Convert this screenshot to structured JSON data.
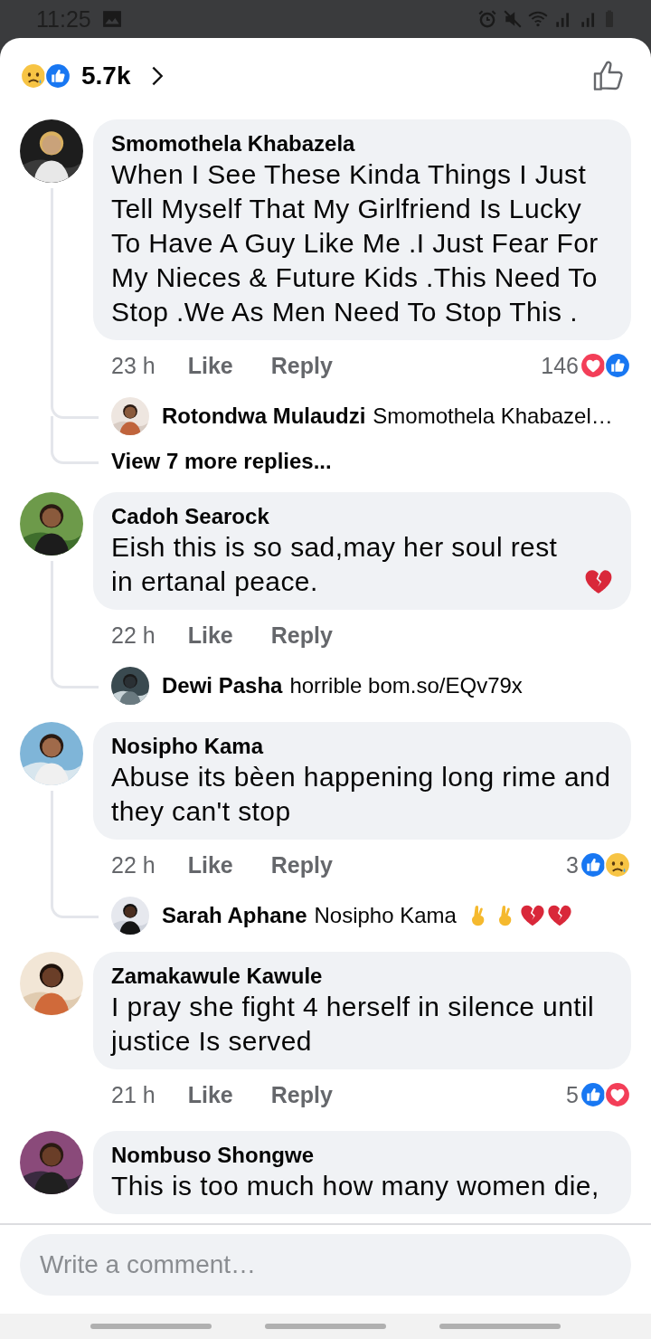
{
  "status_bar": {
    "time": "11:25"
  },
  "header": {
    "reactions": [
      {
        "kind": "sad"
      },
      {
        "kind": "like"
      }
    ],
    "count": "5.7k"
  },
  "comments": [
    {
      "author": "Smomothela Khabazela",
      "text": "When I See These Kinda Things I Just Tell Myself That My Girlfriend Is Lucky To Have A Guy Like Me .I Just Fear For My Nieces & Future Kids .This Need To Stop .We As Men Need To Stop This .",
      "time": "23 h",
      "like_label": "Like",
      "reply_label": "Reply",
      "reaction_count": "146",
      "reactions": [
        {
          "kind": "love"
        },
        {
          "kind": "like"
        }
      ],
      "replies": [
        {
          "author": "Rotondwa Mulaudzi",
          "text": "Smomothela Khabazel…"
        }
      ],
      "more_replies": "View 7 more replies..."
    },
    {
      "author": "Cadoh Searock",
      "text": "Eish this is so sad,may her soul rest in ertanal peace.",
      "emojis": [
        {
          "kind": "broken_heart"
        }
      ],
      "time": "22 h",
      "like_label": "Like",
      "reply_label": "Reply",
      "replies": [
        {
          "author": "Dewi Pasha",
          "text": "horrible bom.so/EQv79x"
        }
      ]
    },
    {
      "author": "Nosipho Kama",
      "text": "Abuse its bèen happening long  rime and they can't stop",
      "time": "22 h",
      "like_label": "Like",
      "reply_label": "Reply",
      "reaction_count": "3",
      "reactions": [
        {
          "kind": "like"
        },
        {
          "kind": "sad"
        }
      ],
      "replies": [
        {
          "author": "Sarah Aphane",
          "text": "Nosipho Kama",
          "emojis": [
            {
              "kind": "crossed_fingers"
            },
            {
              "kind": "crossed_fingers"
            },
            {
              "kind": "broken_heart"
            },
            {
              "kind": "broken_heart"
            }
          ]
        }
      ]
    },
    {
      "author": "Zamakawule Kawule",
      "text": "I pray she fight 4 herself in silence until justice Is served",
      "time": "21 h",
      "like_label": "Like",
      "reply_label": "Reply",
      "reaction_count": "5",
      "reactions": [
        {
          "kind": "like"
        },
        {
          "kind": "love"
        }
      ]
    },
    {
      "author": "Nombuso Shongwe",
      "text": "This is too much how many women die,"
    }
  ],
  "composer": {
    "placeholder": "Write a comment…"
  }
}
